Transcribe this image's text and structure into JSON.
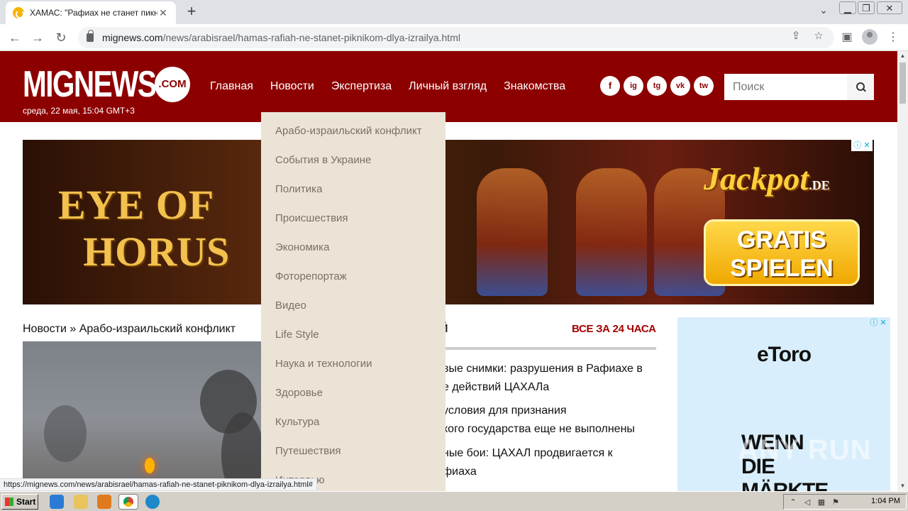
{
  "browser": {
    "tab_title": "ХАМАС: \"Рафиах не станет пикник",
    "url_host": "mignews.com",
    "url_path": "/news/arabisrael/hamas-rafiah-ne-stanet-piknikom-dlya-izrailya.html",
    "status_url": "https://mignews.com/news/arabisrael/hamas-rafiah-ne-stanet-piknikom-dlya-izrailya.html#"
  },
  "site": {
    "logo_word": "MIGNEWS",
    "logo_com": ".COM",
    "datetime": "среда, 22 мая, 15:04 GMT+3",
    "nav": [
      "Главная",
      "Новости",
      "Экспертиза",
      "Личный взгляд",
      "Знакомства"
    ],
    "social": [
      "f",
      "ig",
      "tg",
      "vk",
      "tw"
    ],
    "search_placeholder": "Поиск"
  },
  "banner": {
    "eye": "EYE OF",
    "horus": "HORUS",
    "jackpot": "Jackpot",
    "jackpot_de": ".DE",
    "gratis": "GRATIS",
    "spielen": "SPIELEN"
  },
  "dropdown": [
    "Арабо-израильский конфликт",
    "События в Украине",
    "Политика",
    "Происшествия",
    "Экономика",
    "Фоторепортаж",
    "Видео",
    "Life Style",
    "Наука и технологии",
    "Здоровье",
    "Культура",
    "Путешествия",
    "Интервью"
  ],
  "breadcrumb": {
    "section": "Новости",
    "sep": " » ",
    "subsection": "Арабо-израильский конфликт"
  },
  "news": {
    "head_tail": "Й",
    "all_label": "ВСЕ ЗА 24 ЧАСА",
    "items": [
      {
        "line1": "вые снимки: разрушения в Рафиахе в",
        "line2": "е действий ЦАХАЛа"
      },
      {
        "line1": "условия для признания",
        "line2": "кого государства еще не выполнены"
      },
      {
        "line1": "ные бои: ЦАХАЛ продвигается к",
        "line2": "фиаха"
      }
    ]
  },
  "side_ad": {
    "brand": "eToro",
    "slogan": "WENN DIE MÄRKTE"
  },
  "watermark": "ANY RUN",
  "taskbar": {
    "start": "Start",
    "clock": "1:04 PM"
  },
  "colors": {
    "header_bg": "#8d0000",
    "dropdown_bg": "#ebe4d6",
    "accent_red": "#a40000"
  }
}
